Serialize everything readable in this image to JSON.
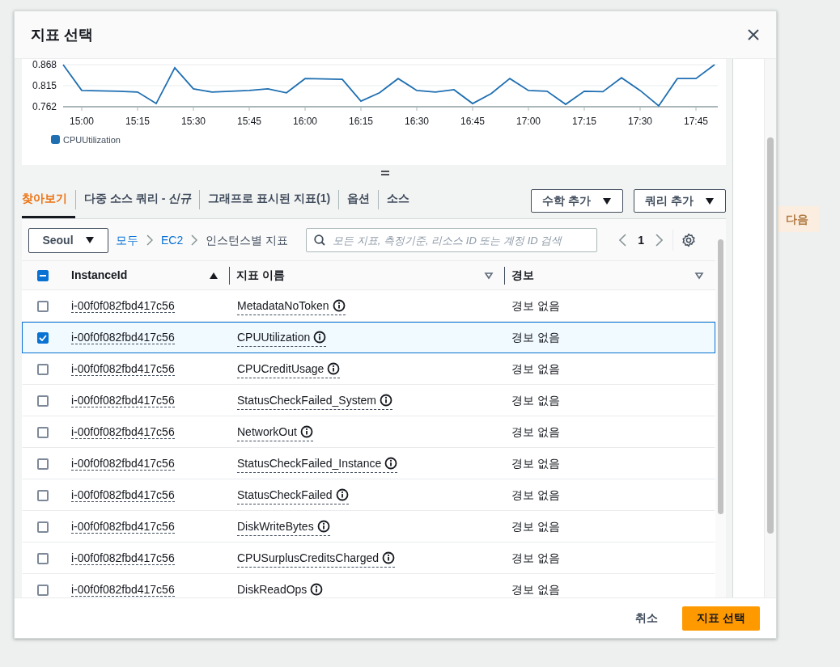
{
  "background": {
    "next_button": "다음"
  },
  "dialog": {
    "title": "지표 선택"
  },
  "chart": {
    "chart_data": {
      "type": "line",
      "categories": [
        null,
        "15:00",
        null,
        null,
        "15:15",
        null,
        null,
        "15:30",
        null,
        null,
        "15:45",
        null,
        null,
        "16:00",
        null,
        null,
        "16:15",
        null,
        null,
        "16:30",
        null,
        null,
        "16:45",
        null,
        null,
        "17:00",
        null,
        null,
        "17:15",
        null,
        null,
        "17:30",
        null,
        null,
        "17:45",
        null
      ],
      "series": [
        {
          "name": "CPUUtilization",
          "color": "#1f6fb2",
          "values": [
            0.868,
            0.803,
            0.802,
            0.801,
            0.799,
            0.77,
            0.86,
            0.807,
            0.799,
            0.801,
            0.803,
            0.807,
            0.797,
            0.833,
            0.832,
            0.831,
            0.776,
            0.797,
            0.833,
            0.803,
            0.799,
            0.805,
            0.77,
            0.795,
            0.833,
            0.803,
            0.801,
            0.768,
            0.801,
            0.8,
            0.835,
            0.803,
            0.764,
            0.833,
            0.833,
            0.868
          ]
        }
      ],
      "ylim": [
        0.762,
        0.868
      ],
      "yticks": [
        {
          "value": 0.762,
          "label": "0.762"
        },
        {
          "value": 0.815,
          "label": "0.815"
        },
        {
          "value": 0.868,
          "label": "0.868"
        }
      ]
    }
  },
  "tabs": [
    {
      "label": "찾아보기",
      "selected": true
    },
    {
      "label": "다중 소스 쿼리 -",
      "tag": "신규",
      "selected": false
    },
    {
      "label": "그래프로 표시된 지표(1)",
      "selected": false
    },
    {
      "label": "옵션",
      "selected": false
    },
    {
      "label": "소스",
      "selected": false
    }
  ],
  "actions": [
    "수학 추가",
    "쿼리 추가"
  ],
  "browse": {
    "region": "Seoul",
    "breadcrumb": [
      {
        "label": "모두",
        "link": true
      },
      {
        "label": "EC2",
        "link": true
      },
      {
        "label": "인스턴스별 지표",
        "link": false
      }
    ],
    "search": {
      "placeholder": "모든 지표, 측정기준, 리소스 ID 또는 계정 ID 검색"
    },
    "page": "1"
  },
  "table": {
    "select_all_partial": true,
    "columns": [
      {
        "label": "InstanceId",
        "sorted": true
      },
      {
        "label": "지표 이름",
        "sorted": false
      },
      {
        "label": "경보",
        "sorted": false
      }
    ],
    "rows": [
      {
        "instance_id": "i-00f0f082fbd417c56",
        "metric": "MetadataNoToken",
        "alarm": "경보 없음",
        "selected": false
      },
      {
        "instance_id": "i-00f0f082fbd417c56",
        "metric": "CPUUtilization",
        "alarm": "경보 없음",
        "selected": true
      },
      {
        "instance_id": "i-00f0f082fbd417c56",
        "metric": "CPUCreditUsage",
        "alarm": "경보 없음",
        "selected": false
      },
      {
        "instance_id": "i-00f0f082fbd417c56",
        "metric": "StatusCheckFailed_System",
        "alarm": "경보 없음",
        "selected": false
      },
      {
        "instance_id": "i-00f0f082fbd417c56",
        "metric": "NetworkOut",
        "alarm": "경보 없음",
        "selected": false
      },
      {
        "instance_id": "i-00f0f082fbd417c56",
        "metric": "StatusCheckFailed_Instance",
        "alarm": "경보 없음",
        "selected": false
      },
      {
        "instance_id": "i-00f0f082fbd417c56",
        "metric": "StatusCheckFailed",
        "alarm": "경보 없음",
        "selected": false
      },
      {
        "instance_id": "i-00f0f082fbd417c56",
        "metric": "DiskWriteBytes",
        "alarm": "경보 없음",
        "selected": false
      },
      {
        "instance_id": "i-00f0f082fbd417c56",
        "metric": "CPUSurplusCreditsCharged",
        "alarm": "경보 없음",
        "selected": false
      },
      {
        "instance_id": "i-00f0f082fbd417c56",
        "metric": "DiskReadOps",
        "alarm": "경보 없음",
        "selected": false
      }
    ]
  },
  "footer": {
    "cancel": "취소",
    "confirm": "지표 선택"
  }
}
